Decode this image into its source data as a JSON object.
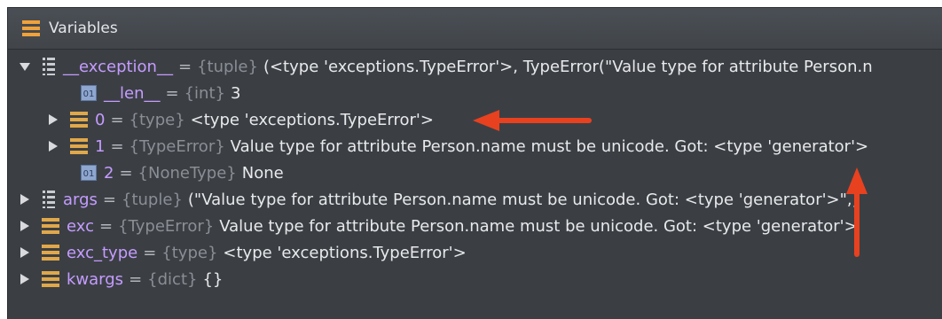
{
  "header": {
    "title": "Variables",
    "icon": "variables-icon"
  },
  "rows": [
    {
      "name": "__exception__",
      "type": "{tuple}",
      "value": "(<type 'exceptions.TypeError'>, TypeError(\"Value type for attribute Person.n",
      "expanded": true,
      "icon": "tuple-icon"
    },
    {
      "name": "__len__",
      "type": "{int}",
      "value": "3",
      "icon": "int-icon"
    },
    {
      "name": "0",
      "type": "{type}",
      "value": "<type 'exceptions.TypeError'>",
      "expanded": false,
      "icon": "object-icon"
    },
    {
      "name": "1",
      "type": "{TypeError}",
      "value": "Value type for attribute Person.name must be unicode. Got: <type 'generator'>",
      "expanded": false,
      "icon": "object-icon"
    },
    {
      "name": "2",
      "type": "{NoneType}",
      "value": "None",
      "icon": "none-icon"
    },
    {
      "name": "args",
      "type": "{tuple}",
      "value": "(\"Value type for attribute Person.name must be unicode. Got: <type 'generator'>\",)",
      "expanded": false,
      "icon": "tuple-icon"
    },
    {
      "name": "exc",
      "type": "{TypeError}",
      "value": "Value type for attribute Person.name must be unicode. Got: <type 'generator'>",
      "expanded": false,
      "icon": "object-icon"
    },
    {
      "name": "exc_type",
      "type": "{type}",
      "value": "<type 'exceptions.TypeError'>",
      "expanded": false,
      "icon": "object-icon"
    },
    {
      "name": "kwargs",
      "type": "{dict}",
      "value": "{}",
      "expanded": false,
      "icon": "object-icon"
    }
  ],
  "annotations": {
    "arrow_color": "#e8411f"
  }
}
